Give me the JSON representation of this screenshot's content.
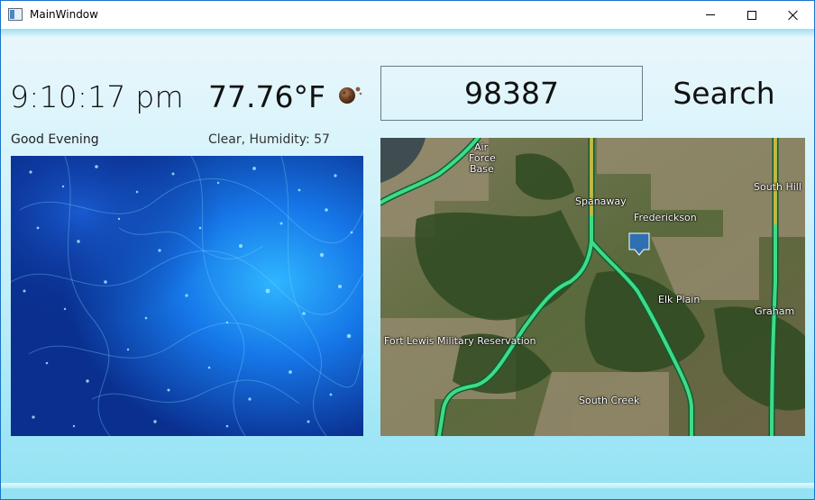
{
  "window": {
    "title": "MainWindow"
  },
  "clock": {
    "time": "9:10:17 pm",
    "greeting": "Good Evening"
  },
  "weather": {
    "temperature": "77.76°F",
    "conditions": "Clear, Humidity: 57",
    "icon": "moon-icon"
  },
  "search": {
    "zip_value": "98387",
    "button_label": "Search"
  },
  "map": {
    "labels": {
      "air_force_base": "Air Force Base",
      "air_force_base_line1": "Air",
      "air_force_base_line2": "Force",
      "air_force_base_line3": "Base",
      "spanaway": "Spanaway",
      "frederickson": "Frederickson",
      "south_hill": "South Hill",
      "elk_plain": "Elk Plain",
      "graham": "Graham",
      "fort_lewis": "Fort Lewis Military Reservation",
      "south_creek": "South Creek"
    },
    "marker": "location-pin-icon",
    "colors": {
      "highway": "#3ddc84",
      "highway_alt": "#f5a623"
    }
  }
}
